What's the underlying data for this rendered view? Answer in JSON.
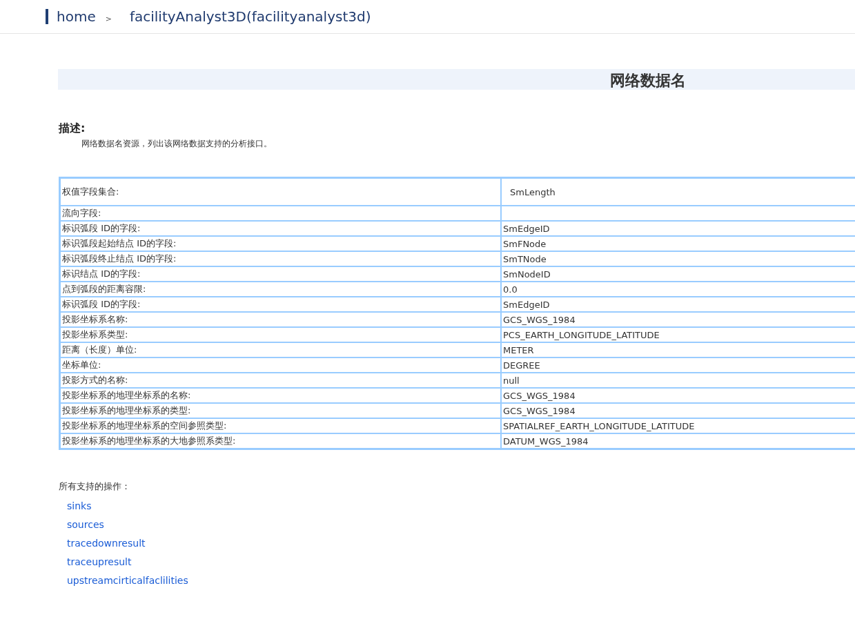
{
  "breadcrumb": {
    "items": [
      {
        "label": "home"
      },
      {
        "label": "facilityAnalyst3D(facilityanalyst3d)"
      }
    ],
    "separator": ">"
  },
  "title": "网络数据名",
  "description": {
    "heading": "描述:",
    "text": "网络数据名资源，列出该网络数据支持的分析接口。"
  },
  "table": {
    "rows": [
      {
        "label": "权值字段集合:",
        "value": "SmLength",
        "kind": "tall"
      },
      {
        "label": "流向字段:",
        "value": "",
        "kind": "plain"
      },
      {
        "label": "标识弧段 ID的字段:",
        "value": "SmEdgeID",
        "kind": "plain"
      },
      {
        "label": "标识弧段起始结点 ID的字段:",
        "value": "SmFNode",
        "kind": "plain"
      },
      {
        "label": "标识弧段终止结点 ID的字段:",
        "value": "SmTNode",
        "kind": "plain"
      },
      {
        "label": "标识结点 ID的字段:",
        "value": "SmNodeID",
        "kind": "plain"
      },
      {
        "label": "点到弧段的距离容限:",
        "value": "0.0",
        "kind": "plain"
      },
      {
        "label": "标识弧段 ID的字段:",
        "value": "SmEdgeID",
        "kind": "plain"
      },
      {
        "label": "投影坐标系名称:",
        "value": "GCS_WGS_1984",
        "kind": "plain"
      },
      {
        "label": "投影坐标系类型:",
        "value": "PCS_EARTH_LONGITUDE_LATITUDE",
        "kind": "plain"
      },
      {
        "label": "距离（长度）单位:",
        "value": "METER",
        "kind": "plain"
      },
      {
        "label": "坐标单位:",
        "value": "DEGREE",
        "kind": "plain"
      },
      {
        "label": "投影方式的名称:",
        "value": "null",
        "kind": "plain"
      },
      {
        "label": "投影坐标系的地理坐标系的名称:",
        "value": "GCS_WGS_1984",
        "kind": "plain"
      },
      {
        "label": "投影坐标系的地理坐标系的类型:",
        "value": "GCS_WGS_1984",
        "kind": "plain"
      },
      {
        "label": "投影坐标系的地理坐标系的空间参照类型:",
        "value": "SPATIALREF_EARTH_LONGITUDE_LATITUDE",
        "kind": "plain"
      },
      {
        "label": "投影坐标系的地理坐标系的大地参照系类型:",
        "value": "DATUM_WGS_1984",
        "kind": "plain"
      }
    ]
  },
  "operations": {
    "heading": "所有支持的操作：",
    "links": [
      {
        "label": "sinks"
      },
      {
        "label": "sources"
      },
      {
        "label": "tracedownresult"
      },
      {
        "label": "traceupresult"
      },
      {
        "label": "upstreamcirticalfaclilities"
      }
    ]
  }
}
